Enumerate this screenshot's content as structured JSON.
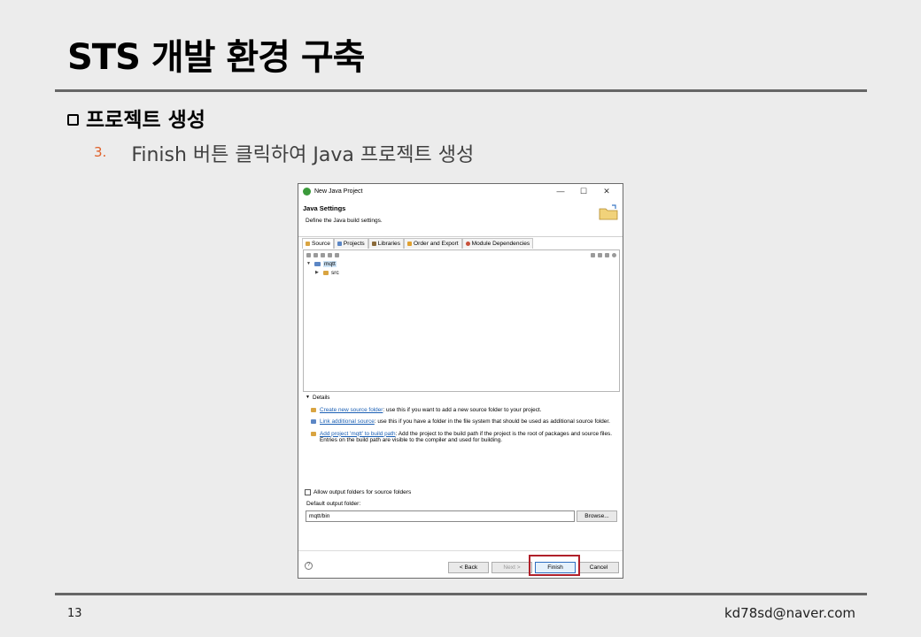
{
  "slide": {
    "title": "STS 개발 환경 구축",
    "section": "프로젝트 생성",
    "step_number": "3.",
    "step_text": "Finish 버튼 클릭하여 Java 프로젝트 생성",
    "page_number": "13",
    "email": "kd78sd@naver.com",
    "accent_color": "#e0612a",
    "highlight_color": "#b0202a"
  },
  "dialog": {
    "window_title": "New Java Project",
    "controls": {
      "minimize": "—",
      "maximize": "☐",
      "close": "✕"
    },
    "settings_title": "Java Settings",
    "settings_desc": "Define the Java build settings.",
    "tabs": [
      "Source",
      "Projects",
      "Libraries",
      "Order and Export",
      "Module Dependencies"
    ],
    "tree": {
      "project": "mqtt",
      "folder": "src"
    },
    "details": {
      "heading": "Details",
      "items": [
        {
          "link": "Create new source folder",
          "text": ": use this if you want to add a new source folder to your project."
        },
        {
          "link": "Link additional source",
          "text": ": use this if you have a folder in the file system that should be used as additional source folder."
        },
        {
          "link": "Add project 'mqtt' to build path",
          "text": ": Add the project to the build path if the project is the root of packages and source files. Entries on the build path are visible to the compiler and used for building."
        }
      ]
    },
    "allow_output_folders": "Allow output folders for source folders",
    "default_output_label": "Default output folder:",
    "default_output_value": "mqtt/bin",
    "browse_label": "Browse...",
    "help": "?",
    "buttons": {
      "back": "< Back",
      "next": "Next >",
      "finish": "Finish",
      "cancel": "Cancel"
    }
  }
}
